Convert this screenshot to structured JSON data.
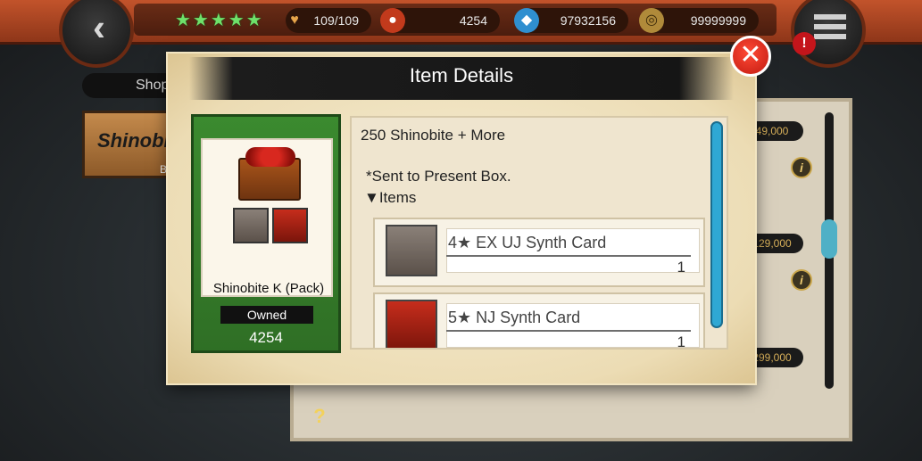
{
  "topbar": {
    "stars": "★★★★★",
    "stamina": "109/109",
    "shinobite": "4254",
    "ryo": "97932156",
    "coins": "99999999",
    "alert": "!"
  },
  "background": {
    "shop_tab_label": "Shop",
    "banner_label": "Shinobi",
    "banner_sub": "B",
    "prices": [
      "49,000",
      "129,000",
      "299,000"
    ]
  },
  "dialog": {
    "title": "Item Details",
    "close_glyph": "✕",
    "item": {
      "name": "Shinobite K (Pack)",
      "owned_label": "Owned",
      "owned_value": "4254"
    },
    "detail": {
      "title": "250 Shinobite + More",
      "note": "*Sent to Present Box.",
      "items_header": "▼Items",
      "entries": [
        {
          "name": "4★ EX UJ Synth Card",
          "qty": "1"
        },
        {
          "name": "5★ NJ Synth Card",
          "qty": "1"
        }
      ]
    }
  },
  "colors": {
    "accent_green": "#3b8a2f",
    "scroll_blue": "#2fa8d4",
    "close_red": "#d4261a"
  },
  "icons": [
    "back-chevron-icon",
    "menu-icon",
    "heart-icon",
    "shinobite-icon",
    "ryo-icon",
    "coin-icon",
    "close-icon",
    "info-icon",
    "help-icon"
  ]
}
